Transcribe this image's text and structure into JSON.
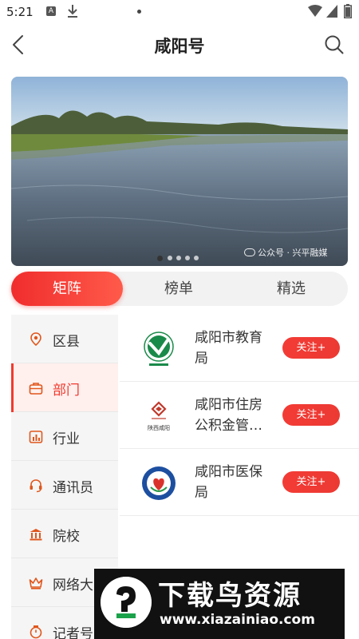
{
  "status_bar": {
    "time": "5:21",
    "a_icon": "A"
  },
  "header": {
    "title": "咸阳号"
  },
  "banner": {
    "watermark": "公众号 · 兴平融媒",
    "slide_count": 5,
    "active_slide": 1
  },
  "tabs": [
    {
      "label": "矩阵",
      "active": true
    },
    {
      "label": "榜单",
      "active": false
    },
    {
      "label": "精选",
      "active": false
    }
  ],
  "sidebar": {
    "items": [
      {
        "label": "区县",
        "icon": "location-pin-icon",
        "active": false
      },
      {
        "label": "部门",
        "icon": "briefcase-icon",
        "active": true
      },
      {
        "label": "行业",
        "icon": "bar-chart-icon",
        "active": false
      },
      {
        "label": "通讯员",
        "icon": "headset-icon",
        "active": false
      },
      {
        "label": "院校",
        "icon": "institution-icon",
        "active": false
      },
      {
        "label": "网络大",
        "icon": "crown-icon",
        "active": false
      },
      {
        "label": "记者号",
        "icon": "reporter-icon",
        "active": false
      }
    ]
  },
  "orgs": [
    {
      "name": "咸阳市教育局",
      "name_line1": "咸阳市教育",
      "name_line2": "局",
      "follow_label": "关注+",
      "logo": "education-bureau-logo"
    },
    {
      "name": "咸阳市住房公积金管…",
      "name_line1": "咸阳市住房",
      "name_line2": "公积金管…",
      "follow_label": "关注+",
      "logo": "housing-fund-logo",
      "logo_text": "陕西咸阳"
    },
    {
      "name": "咸阳市医保局",
      "name_line1": "咸阳市医保",
      "name_line2": "局",
      "follow_label": "关注+",
      "logo": "medical-insurance-logo"
    }
  ],
  "overlay": {
    "title": "下载鸟资源",
    "url": "www.xiazainiao.com"
  },
  "colors": {
    "accent": "#f03a2e",
    "tab_bg": "#f2f2f2",
    "sidebar_bg": "#f5f5f5"
  }
}
